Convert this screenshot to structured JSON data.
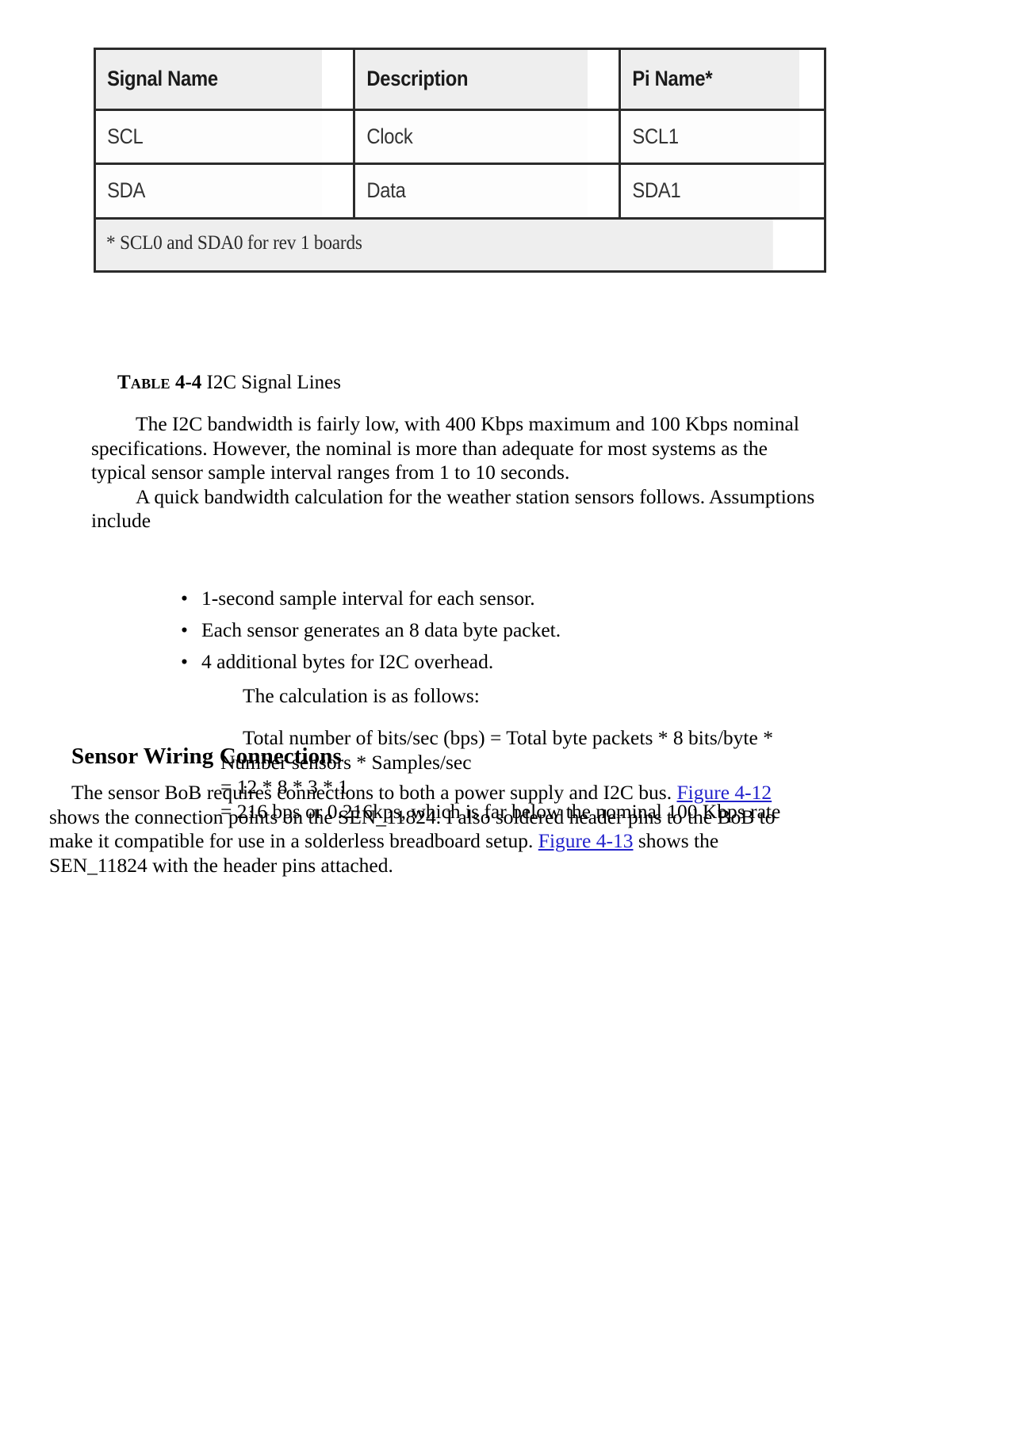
{
  "document": {
    "table_figure": {
      "columns": [
        "Signal Name",
        "Description",
        "Pi Name*"
      ],
      "rows": [
        [
          "SCL",
          "Clock",
          "SCL1"
        ],
        [
          "SDA",
          "Data",
          "SDA1"
        ]
      ],
      "footnote": "* SCL0 and SDA0 for rev 1 boards"
    },
    "caption": {
      "keyword": "Table",
      "number": "4-4",
      "text": "I2C Signal Lines"
    },
    "paragraphs": [
      "The I2C bandwidth is fairly low, with 400 Kbps maximum and 100 Kbps nominal specifications. However, the nominal is more than adequate for most systems as the typical sensor sample interval ranges from 1 to 10 seconds.",
      "A quick bandwidth calculation for the weather station sensors follows. Assumptions include"
    ],
    "bullets": [
      {
        "marker": "•",
        "text": "1-second sample interval for each sensor."
      },
      {
        "marker": "•",
        "text": "Each sensor generates an 8 data byte packet."
      },
      {
        "marker": "•",
        "text": "4 additional bytes for I2C overhead."
      }
    ],
    "calculation": {
      "lead": "The calculation is as follows:",
      "line1": "Total number of bits/sec (bps) = Total byte packets * 8 bits/byte *",
      "line2": "Number sensors * Samples/sec",
      "line3": "= 12 * 8 * 3 * 1",
      "line4": "= 216 bps or 0.216kps, which is far below the nominal 100 Kbps rate"
    },
    "section_heading": "Sensor Wiring Connections",
    "closing": {
      "seg1": "The sensor BoB requires connections to both a power supply and I2C bus. ",
      "link1": "Figure 4-12",
      "seg2": " shows the connection points on the SEN_11824. I also soldered header pins to the BoB to make it compatible for use in a solderless breadboard setup. ",
      "link2": "Figure 4-13",
      "seg3": " shows the SEN_11824 with the header pins attached."
    },
    "colors": {
      "link": "#2222cc",
      "table_border": "#2b2b2b",
      "table_header_bg": "#eeeeee",
      "text": "#000000"
    }
  }
}
